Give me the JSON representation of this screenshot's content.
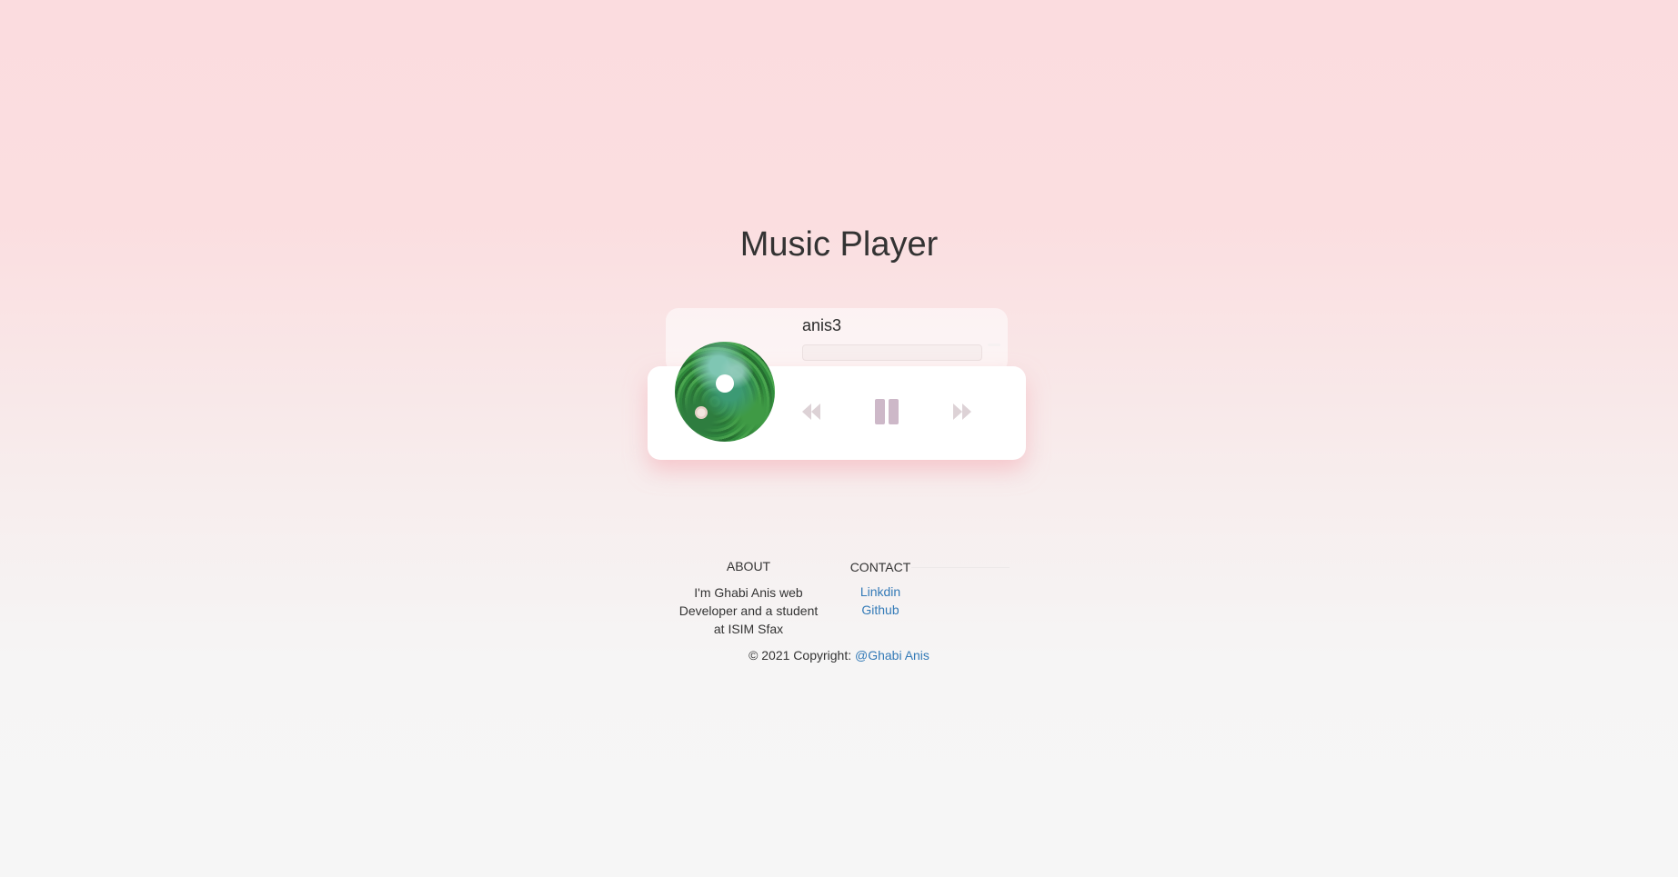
{
  "page": {
    "title": "Music Player"
  },
  "player": {
    "song_title": "anis3",
    "progress_percent": 0,
    "controls": {
      "prev_icon": "backward-icon",
      "play_pause_icon": "pause-icon",
      "next_icon": "forward-icon"
    },
    "album_art": "album-cover-disc",
    "colors": {
      "control_muted": "#ddd2d6",
      "pause_accent": "#cdb8c8",
      "card_shadow": "#f4aab2"
    }
  },
  "footer": {
    "about": {
      "heading": "ABOUT",
      "text": "I'm Ghabi Anis web Developer and a student at ISIM Sfax"
    },
    "contact": {
      "heading": "CONTACT",
      "links": [
        "Linkdin",
        "Github"
      ]
    },
    "copyright": {
      "prefix": "© 2021 Copyright: ",
      "author_link": "@Ghabi Anis"
    },
    "link_color": "#337ab7"
  }
}
